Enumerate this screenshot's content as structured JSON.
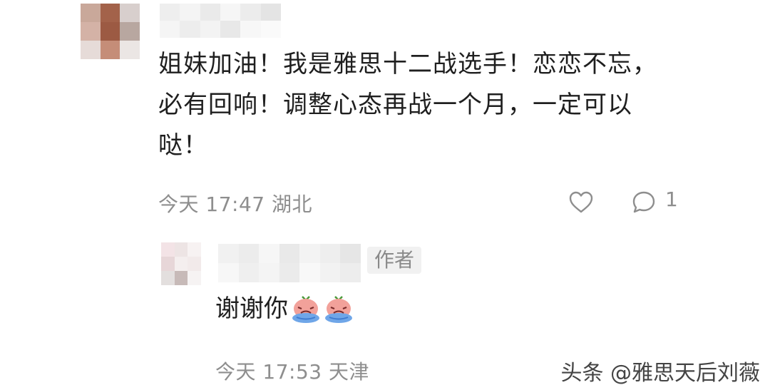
{
  "comment": {
    "text": "姐妹加油！我是雅思十二战选手！恋恋不忘，必有回响！调整心态再战一个月，一定可以哒！",
    "meta": "今天 17:47  湖北",
    "reply_count": "1",
    "like_icon": "heart-outline-icon",
    "reply_icon": "comment-bubble-icon"
  },
  "reply": {
    "badge": "作者",
    "text": "谢谢你",
    "emoji_icon": "crying-emoji-icon",
    "meta": "今天 17:53  天津"
  },
  "watermark": "头条 @雅思天后刘薇",
  "colors": {
    "text": "#1f1f1f",
    "meta": "#8e8e8e",
    "badge_bg": "#f1f1f1"
  }
}
